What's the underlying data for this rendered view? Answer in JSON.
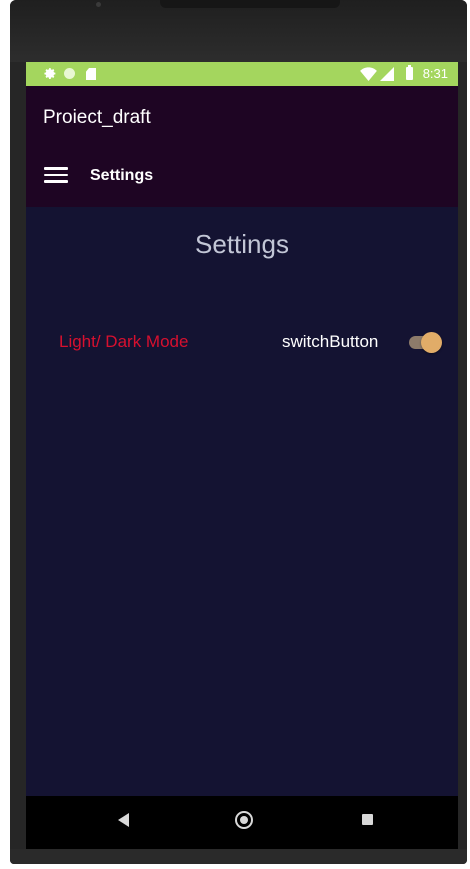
{
  "status_bar": {
    "time": "8:31",
    "icons": [
      "gear-icon",
      "circle-icon",
      "sd-card-icon",
      "wifi-icon",
      "signal-icon",
      "battery-icon"
    ]
  },
  "app_bar": {
    "app_title": "Proiect_draft",
    "toolbar_title": "Settings",
    "menu_icon": "hamburger-menu-icon"
  },
  "main": {
    "heading": "Settings",
    "mode_label": "Light/ Dark Mode",
    "switch_label": "switchButton",
    "switch_on": true
  },
  "nav_bar": {
    "icons": [
      "back-icon",
      "home-icon",
      "recents-icon"
    ]
  },
  "colors": {
    "status_bar": "#a4d65e",
    "app_bar": "#1e0523",
    "background": "#141332",
    "mode_label": "#d7102f",
    "switch_thumb": "#e1ac68",
    "switch_track": "#8d7b6a"
  }
}
